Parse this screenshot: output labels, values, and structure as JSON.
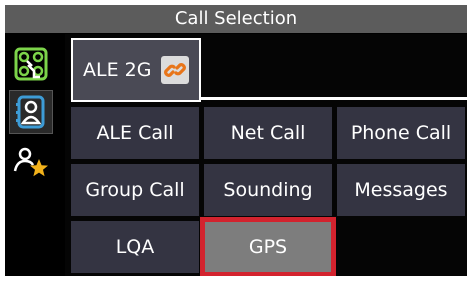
{
  "window": {
    "title": "Call Selection"
  },
  "sidebar": {
    "items": [
      {
        "name": "network-nodes-icon",
        "active": false
      },
      {
        "name": "contact-icon",
        "active": true
      },
      {
        "name": "favorite-contact-icon",
        "active": false
      }
    ]
  },
  "mode_tab": {
    "label": "ALE 2G",
    "badge_icon": "link-icon"
  },
  "grid": {
    "cells": [
      {
        "label": "ALE Call"
      },
      {
        "label": "Net Call"
      },
      {
        "label": "Phone Call"
      },
      {
        "label": "Group Call"
      },
      {
        "label": "Sounding"
      },
      {
        "label": "Messages"
      },
      {
        "label": "LQA"
      },
      {
        "label": "GPS",
        "selected": true
      }
    ]
  },
  "colors": {
    "title_bar": "#5c5c5c",
    "cell_bg": "#343442",
    "cell_selected_bg": "#7d7d7d",
    "selection_outline": "#d3232e",
    "icon_green": "#7cd44a",
    "icon_blue": "#3d9cd6",
    "icon_gold": "#f2b21b",
    "link_orange": "#e8751a"
  }
}
